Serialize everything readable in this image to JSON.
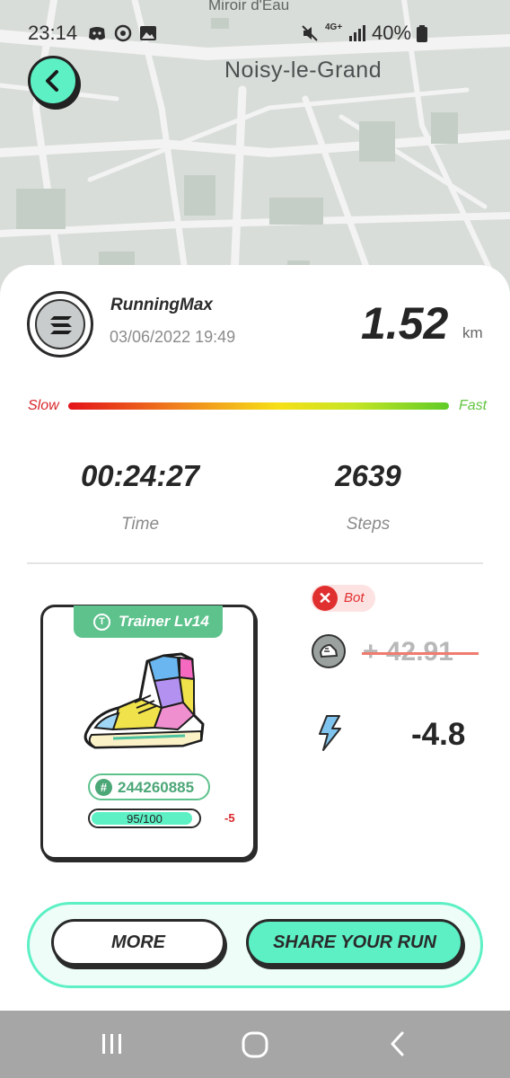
{
  "map": {
    "label_top": "Miroir d'Eau",
    "city": "Noisy-le-Grand"
  },
  "status_bar": {
    "time": "23:14",
    "network": "4G+",
    "battery": "40%",
    "icons": [
      "discord-icon",
      "sync-icon",
      "gallery-icon",
      "mute-icon",
      "network-icon",
      "signal-icon",
      "battery-icon"
    ]
  },
  "run": {
    "username": "RunningMax",
    "datetime": "03/06/2022 19:49",
    "distance": "1.52",
    "distance_unit": "km",
    "speed_slow_label": "Slow",
    "speed_fast_label": "Fast",
    "time_value": "00:24:27",
    "time_label": "Time",
    "steps_value": "2639",
    "steps_label": "Steps"
  },
  "sneaker_card": {
    "tag_icon": "T",
    "type_label": "Trainer Lv14",
    "id_symbol": "#",
    "id": "244260885",
    "durability_text": "95/100",
    "durability_fraction": 0.95,
    "durability_change": "-5"
  },
  "rewards": {
    "bot_symbol": "✕",
    "bot_label": "Bot",
    "earned": "+ 42.91",
    "energy": "-4.8"
  },
  "actions": {
    "more_label": "MORE",
    "share_label": "SHARE YOUR RUN"
  },
  "colors": {
    "accent": "#5cf0c4",
    "green": "#5ec28d",
    "red": "#e02f2f"
  }
}
